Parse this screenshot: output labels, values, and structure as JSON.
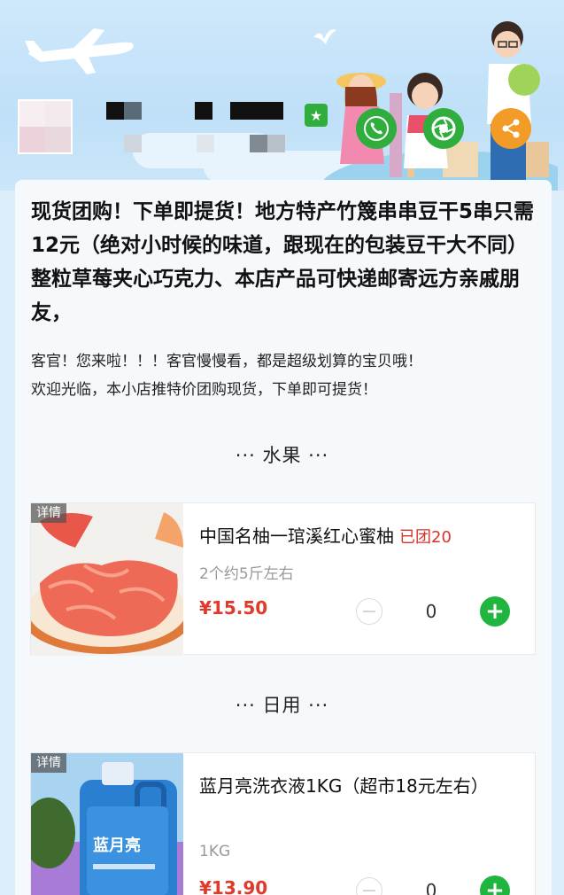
{
  "header": {
    "shop_badge_icon": "star-flag-icon",
    "phone_icon": "phone-icon",
    "camera_icon": "camera-lens-icon",
    "share_icon": "share-icon",
    "phone_color": "#2fae3d",
    "share_color": "#f29b26"
  },
  "notice": {
    "text": "现货团购！下单即提货！地方特产竹篾串串豆干5串只需12元（绝对小时候的味道，跟现在的包装豆干大不同）整粒草莓夹心巧克力、本店产品可快递邮寄远方亲戚朋友，"
  },
  "welcome": {
    "line1": "客官！您来啦！！！客官慢慢看，都是超级划算的宝贝哦！",
    "line2": "欢迎光临，本小店推特价团购现货，下单即可提货！"
  },
  "sections": [
    {
      "title": "··· 水果 ···",
      "products": [
        {
          "tag": "详情",
          "name": "中国名柚一琯溪红心蜜柚",
          "sold": "已团20",
          "spec": "2个约5斤左右",
          "price": "¥15.50",
          "qty": "0"
        }
      ]
    },
    {
      "title": "··· 日用 ···",
      "products": [
        {
          "tag": "详情",
          "name": "蓝月亮洗衣液1KG（超市18元左右）",
          "spec": "1KG",
          "price": "¥13.90",
          "qty": "0",
          "brand_on_image": "蓝月亮"
        }
      ]
    }
  ]
}
